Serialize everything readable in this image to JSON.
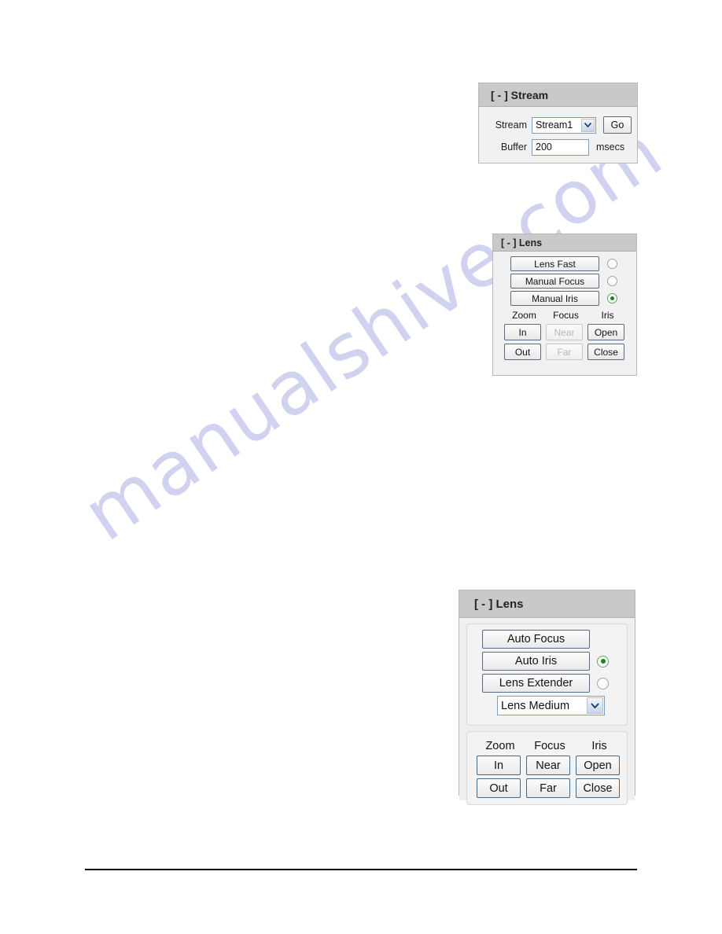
{
  "watermark": {
    "text": "manualshive.com"
  },
  "stream_panel": {
    "title": "[ - ] Stream",
    "collapse_toggle": "[ - ]",
    "stream_label": "Stream",
    "stream_select": {
      "value": "Stream1",
      "options": [
        "Stream1"
      ]
    },
    "go_label": "Go",
    "buffer_label": "Buffer",
    "buffer_value": "200",
    "buffer_unit": "msecs"
  },
  "lens_panel_manual": {
    "title": "[ - ] Lens",
    "modes": [
      {
        "label": "Lens Fast",
        "selected": false
      },
      {
        "label": "Manual Focus",
        "selected": false
      },
      {
        "label": "Manual Iris",
        "selected": true
      }
    ],
    "columns": [
      "Zoom",
      "Focus",
      "Iris"
    ],
    "controls_row1": [
      {
        "label": "In",
        "disabled": false
      },
      {
        "label": "Near",
        "disabled": true
      },
      {
        "label": "Open",
        "disabled": false
      }
    ],
    "controls_row2": [
      {
        "label": "Out",
        "disabled": false
      },
      {
        "label": "Far",
        "disabled": true
      },
      {
        "label": "Close",
        "disabled": false
      }
    ]
  },
  "lens_panel_auto": {
    "title": "[ - ] Lens",
    "modes": [
      {
        "label": "Auto Focus",
        "radio": false,
        "has_radio": false
      },
      {
        "label": "Auto Iris",
        "radio": true,
        "has_radio": true
      },
      {
        "label": "Lens Extender",
        "radio": false,
        "has_radio": true
      }
    ],
    "lens_select": {
      "value": "Lens Medium",
      "options": [
        "Lens Medium"
      ]
    },
    "columns": [
      "Zoom",
      "Focus",
      "Iris"
    ],
    "controls_row1": [
      {
        "label": "In",
        "disabled": false
      },
      {
        "label": "Near",
        "disabled": false
      },
      {
        "label": "Open",
        "disabled": false
      }
    ],
    "controls_row2": [
      {
        "label": "Out",
        "disabled": false
      },
      {
        "label": "Far",
        "disabled": false
      },
      {
        "label": "Close",
        "disabled": false
      }
    ]
  },
  "colors": {
    "panel_header": "#c9c9c9",
    "panel_body": "#f1f1f1",
    "radio_selected": "#17861b",
    "select_border": "#7f9db9",
    "watermark": "#c9c9ee"
  }
}
